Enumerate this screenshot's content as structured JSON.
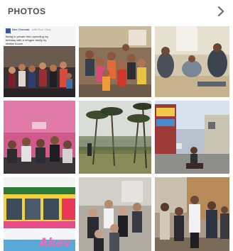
{
  "section": {
    "title": "PHOTOS",
    "more_icon": "chevron-right-icon"
  },
  "post_preview": {
    "author": "Neo Chennai",
    "meta": "with Ravi Yang",
    "text": "Being in private then spending my birthday with a refugee family by shelter house"
  },
  "photos": [
    {
      "name": "photo-1",
      "subject": "group-photo-in-room"
    },
    {
      "name": "photo-2",
      "subject": "group-photo-indoor"
    },
    {
      "name": "photo-3",
      "subject": "people-sitting-on-floor"
    },
    {
      "name": "photo-4",
      "subject": "people-in-pink-room"
    },
    {
      "name": "photo-5",
      "subject": "palm-trees"
    },
    {
      "name": "photo-6",
      "subject": "street-scene"
    },
    {
      "name": "photo-7",
      "subject": "colorful-bus"
    },
    {
      "name": "photo-8",
      "subject": "people-indoors"
    },
    {
      "name": "photo-9",
      "subject": "group-outdoors"
    }
  ],
  "bus_sign": "Ahav"
}
